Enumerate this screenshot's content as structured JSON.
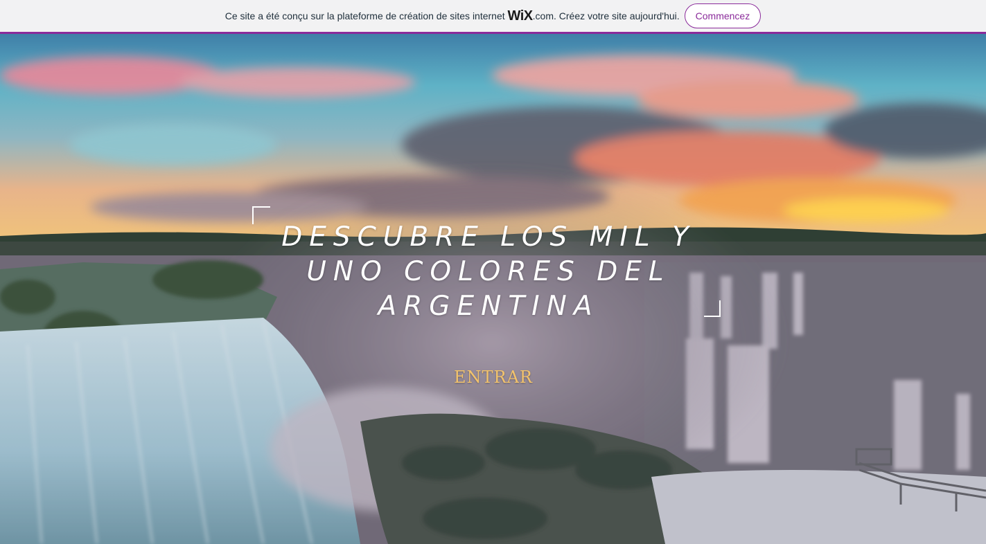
{
  "banner": {
    "text_before": "Ce site a été conçu sur la plateforme de création de sites internet",
    "logo_wix": "WiX",
    "logo_suffix": ".com.",
    "text_after": "Créez votre site aujourd'hui.",
    "cta_label": "Commencez"
  },
  "hero": {
    "headline_line1": "DESCUBRE LOS MIL Y",
    "headline_line2": "UNO COLORES DEL",
    "headline_line3": "ARGENTINA",
    "enter_label": "ENTRAR"
  },
  "colors": {
    "banner_accent": "#8a2a9a",
    "enter_text": "#f3c36c"
  }
}
